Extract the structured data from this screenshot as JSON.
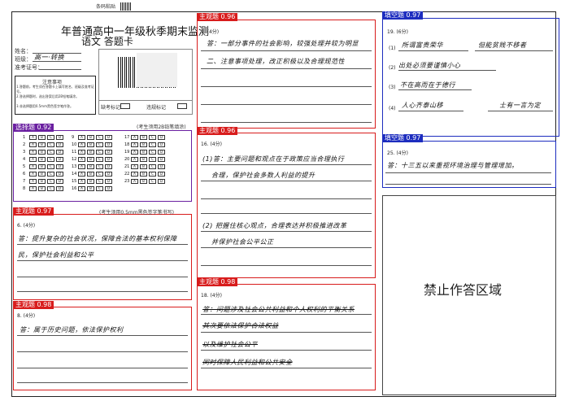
{
  "header": {
    "small_top": "条码粘贴",
    "title_line1": "年普通高中一年级秋季期末监测",
    "title_line2": "语文  答题卡",
    "fields": [
      {
        "label": "姓名：",
        "value": ""
      },
      {
        "label": "班级：",
        "value": "高一·转换"
      },
      {
        "label": "准考证号：",
        "value": ""
      }
    ],
    "notice_title": "注意事项",
    "notice_lines": [
      "1.答题前，考生须在答题卡上填写姓名、班级及准考证号。",
      "2.答选择题时，选出答案后用2B铅笔填涂。",
      "3.非选择题用0.5mm黑色签字笔作答。"
    ],
    "absent_label": "缺考标记",
    "violation_label": "违规标记"
  },
  "sections": {
    "choice": {
      "tag": "选择题 0.92",
      "note": "(考生须用2B铅笔填涂)",
      "rows": [
        "1",
        "2",
        "3",
        "4",
        "5",
        "6",
        "7",
        "8",
        "9",
        "10",
        "11",
        "12",
        "13",
        "14",
        "15",
        "16",
        "17",
        "18",
        "19",
        "20",
        "21",
        "22",
        "23"
      ]
    },
    "q6": {
      "tag": "主观题 0.97",
      "note": "(考生须用0.5mm黑色签字笔书写)",
      "label": "6. (4分)",
      "answer": [
        "答：提升复杂的社会状况，保障合法的基本权利保障",
        "民，保护社会利益和公平"
      ]
    },
    "q8": {
      "tag": "主观题 0.98",
      "label": "8. (4分)",
      "answer": [
        "答：属于历史问题，依法保护权利"
      ]
    },
    "q9": {
      "tag": "主观题 0.96",
      "label": "9. (4分)",
      "answer": [
        "答：一部分事件的社会影响，较强处理并较为明显",
        "二、注意事项处理，改正积极以及合理规范性"
      ]
    },
    "q16": {
      "tag": "主观题 0.96",
      "label": "16. (4分)",
      "answer_a": [
        "(1)答：主要问题和观点在于政策应当合理执行",
        "合理，保护社会多数人利益的提升"
      ],
      "answer_b": [
        "(2) 把握住核心观点，合理表达并积极推进改革",
        "并保护社会公平公正"
      ]
    },
    "q18": {
      "tag": "主观题 0.98",
      "label": "18. (4分)",
      "answer": [
        "答：问题涉及社会公共利益和个人权利的平衡关系",
        "其次要依法保护合法权益",
        "以及维护社会公平",
        "同时保障人民利益和公共安全"
      ]
    },
    "q19": {
      "tag": "填空题 0.97",
      "label": "19. (6分)",
      "items": [
        {
          "num": "(1)",
          "text": "所谓富贵荣华",
          "text2": "但能贫贱不移者"
        },
        {
          "num": "(2)",
          "text": "出处必须要谨慎小心",
          "text2": ""
        },
        {
          "num": "(3)",
          "text": "不在高而在于德行",
          "text2": ""
        },
        {
          "num": "(4)",
          "text": "人心齐泰山移",
          "text2": "士有一言为定"
        }
      ]
    },
    "q25": {
      "tag": "填空题 0.97",
      "label": "25. (4分)",
      "answer": [
        "答：十三五以来重视环境治理与管理增加。"
      ]
    },
    "forbidden": {
      "text": "禁止作答区域"
    }
  }
}
